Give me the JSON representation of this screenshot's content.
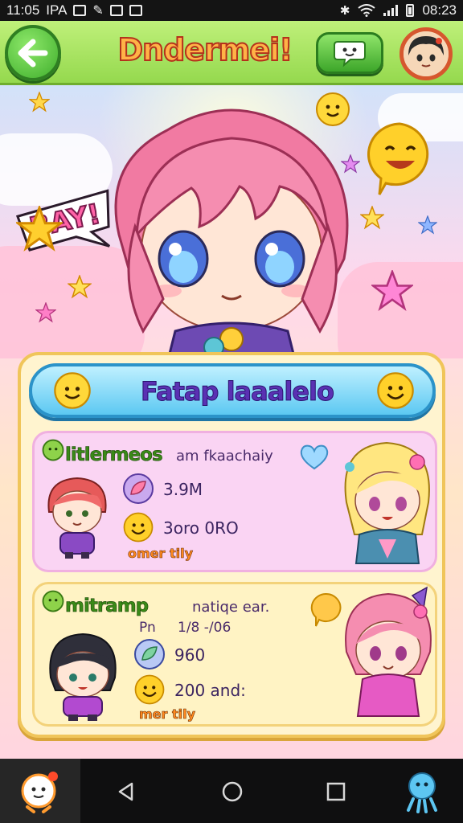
{
  "status_bar": {
    "time": "11:05",
    "label": "IPA",
    "clock_right": "08:23"
  },
  "app_bar": {
    "title": "Dndermei!"
  },
  "hero": {
    "shout": "BAY!"
  },
  "panel": {
    "banner_title": "Fatap laaalelo",
    "cards": [
      {
        "title": "litlermeos",
        "subtitle": "am fkaachaiy",
        "stat1": "3.9M",
        "stat2": "3oro 0RO",
        "tag": "omer tily",
        "like_meter": 0.6
      },
      {
        "title": "mitramp",
        "subtitle": "natiqe ear.",
        "subtitle2_a": "Pn",
        "subtitle2_b": "1/8 -/06",
        "stat1": "960",
        "stat2": "200 and:",
        "tag": "mer tily"
      }
    ]
  },
  "colors": {
    "accent_green": "#95d94e",
    "title_orange": "#ffb347",
    "banner_blue": "#5cc8f2",
    "card_pink": "#fad4f3",
    "card_yellow": "#fff3c4"
  },
  "icons": [
    "back-arrow-icon",
    "chat-bubble-icon",
    "profile-avatar",
    "star-icon",
    "smiley-icon",
    "heart-icon",
    "android-back-icon",
    "android-home-icon",
    "android-recents-icon"
  ]
}
